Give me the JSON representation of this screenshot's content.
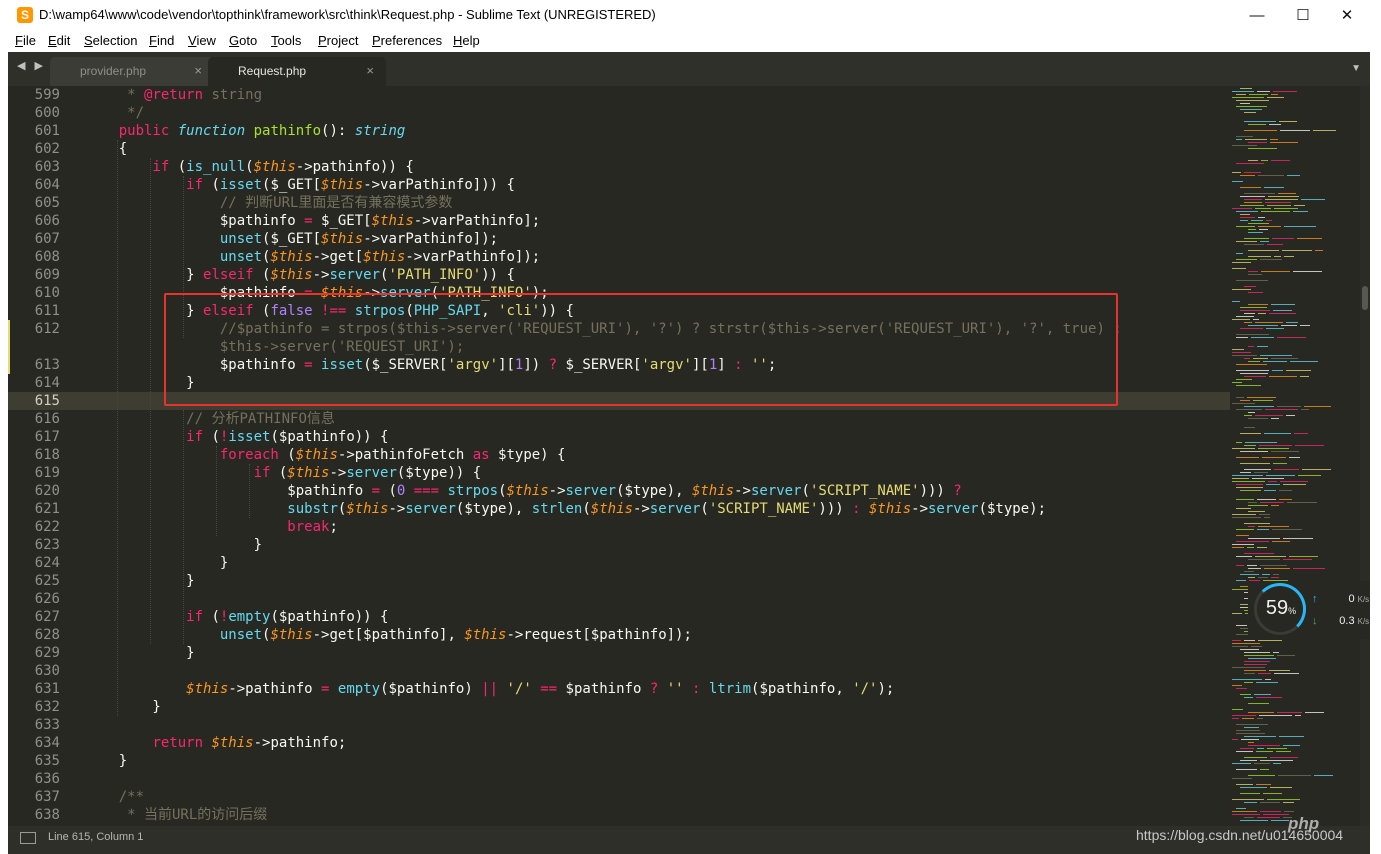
{
  "window": {
    "title": "D:\\wamp64\\www\\code\\vendor\\topthink\\framework\\src\\think\\Request.php - Sublime Text (UNREGISTERED)",
    "app_icon": "sublime-text-icon",
    "controls": {
      "minimize": "—",
      "maximize": "☐",
      "close": "✕"
    }
  },
  "menu": [
    {
      "label": "File",
      "u": "F",
      "rest": "ile"
    },
    {
      "label": "Edit",
      "u": "E",
      "rest": "dit"
    },
    {
      "label": "Selection",
      "u": "S",
      "rest": "election"
    },
    {
      "label": "Find",
      "u": "F",
      "rest": "ind"
    },
    {
      "label": "View",
      "u": "V",
      "rest": "iew"
    },
    {
      "label": "Goto",
      "u": "G",
      "rest": "oto"
    },
    {
      "label": "Tools",
      "u": "T",
      "rest": "ools"
    },
    {
      "label": "Project",
      "u": "P",
      "rest": "roject"
    },
    {
      "label": "Preferences",
      "u": "P",
      "rest": "references"
    },
    {
      "label": "Help",
      "u": "H",
      "rest": "elp"
    }
  ],
  "tabs": [
    {
      "label": "provider.php",
      "active": false
    },
    {
      "label": "Request.php",
      "active": true
    }
  ],
  "tab_close_glyph": "×",
  "nav_arrows": "◀ ▶",
  "tab_menu_glyph": "▼",
  "current_line": 615,
  "code_lines": [
    {
      "n": "599",
      "t": [
        [
          "c",
          "     * "
        ],
        [
          "at",
          "@return"
        ],
        [
          "c",
          " string"
        ]
      ]
    },
    {
      "n": "600",
      "t": [
        [
          "c",
          "     */"
        ]
      ]
    },
    {
      "n": "601",
      "t": [
        [
          "",
          "    "
        ],
        [
          "k",
          "public"
        ],
        [
          "",
          " "
        ],
        [
          "st",
          "function"
        ],
        [
          "",
          " "
        ],
        [
          "f",
          "pathinfo"
        ],
        [
          "",
          "(): "
        ],
        [
          "st",
          "string"
        ]
      ]
    },
    {
      "n": "602",
      "t": [
        [
          "",
          "    {"
        ]
      ]
    },
    {
      "n": "603",
      "t": [
        [
          "",
          "        "
        ],
        [
          "k",
          "if"
        ],
        [
          "",
          " ("
        ],
        [
          "b",
          "is_null"
        ],
        [
          "",
          "("
        ],
        [
          "v",
          "$this"
        ],
        [
          "",
          "->pathinfo)) {"
        ]
      ]
    },
    {
      "n": "604",
      "t": [
        [
          "",
          "            "
        ],
        [
          "k",
          "if"
        ],
        [
          "",
          " ("
        ],
        [
          "b",
          "isset"
        ],
        [
          "",
          "($_GET["
        ],
        [
          "v",
          "$this"
        ],
        [
          "",
          "->varPathinfo])) {"
        ]
      ]
    },
    {
      "n": "605",
      "t": [
        [
          "",
          "                "
        ],
        [
          "c",
          "// 判断URL里面是否有兼容模式参数"
        ]
      ]
    },
    {
      "n": "606",
      "t": [
        [
          "",
          "                $pathinfo "
        ],
        [
          "k",
          "="
        ],
        [
          "",
          " $_GET["
        ],
        [
          "v",
          "$this"
        ],
        [
          "",
          "->varPathinfo];"
        ]
      ]
    },
    {
      "n": "607",
      "t": [
        [
          "",
          "                "
        ],
        [
          "b",
          "unset"
        ],
        [
          "",
          "($_GET["
        ],
        [
          "v",
          "$this"
        ],
        [
          "",
          "->varPathinfo]);"
        ]
      ]
    },
    {
      "n": "608",
      "t": [
        [
          "",
          "                "
        ],
        [
          "b",
          "unset"
        ],
        [
          "",
          "("
        ],
        [
          "v",
          "$this"
        ],
        [
          "",
          "->get["
        ],
        [
          "v",
          "$this"
        ],
        [
          "",
          "->varPathinfo]);"
        ]
      ]
    },
    {
      "n": "609",
      "t": [
        [
          "",
          "            } "
        ],
        [
          "k",
          "elseif"
        ],
        [
          "",
          " ("
        ],
        [
          "v",
          "$this"
        ],
        [
          "",
          "->"
        ],
        [
          "b",
          "server"
        ],
        [
          "",
          "("
        ],
        [
          "s",
          "'PATH_INFO'"
        ],
        [
          "",
          ")) {"
        ]
      ]
    },
    {
      "n": "610",
      "t": [
        [
          "",
          "                $pathinfo "
        ],
        [
          "k",
          "="
        ],
        [
          "",
          " "
        ],
        [
          "v",
          "$this"
        ],
        [
          "",
          "->"
        ],
        [
          "b",
          "server"
        ],
        [
          "",
          "("
        ],
        [
          "s",
          "'PATH_INFO'"
        ],
        [
          "",
          ");"
        ]
      ]
    },
    {
      "n": "611",
      "t": [
        [
          "",
          "            } "
        ],
        [
          "k",
          "elseif"
        ],
        [
          "",
          " ("
        ],
        [
          "n",
          "false"
        ],
        [
          "",
          " "
        ],
        [
          "k",
          "!=="
        ],
        [
          "",
          " "
        ],
        [
          "b",
          "strpos"
        ],
        [
          "",
          "("
        ],
        [
          "b",
          "PHP_SAPI"
        ],
        [
          "",
          ", "
        ],
        [
          "s",
          "'cli'"
        ],
        [
          "",
          ")) {"
        ]
      ]
    },
    {
      "n": "612",
      "t": [
        [
          "",
          "                "
        ],
        [
          "c",
          "//$pathinfo = strpos($this->server('REQUEST_URI'), '?') ? strstr($this->server('REQUEST_URI'), '?', true) :"
        ]
      ]
    },
    {
      "n": "",
      "t": [
        [
          "",
          "                "
        ],
        [
          "c",
          "$this->server('REQUEST_URI');"
        ]
      ]
    },
    {
      "n": "613",
      "t": [
        [
          "",
          "                $pathinfo "
        ],
        [
          "k",
          "="
        ],
        [
          "",
          " "
        ],
        [
          "b",
          "isset"
        ],
        [
          "",
          "($_SERVER["
        ],
        [
          "s",
          "'argv'"
        ],
        [
          "",
          "]["
        ],
        [
          "n",
          "1"
        ],
        [
          "",
          "]) "
        ],
        [
          "k",
          "?"
        ],
        [
          "",
          " $_SERVER["
        ],
        [
          "s",
          "'argv'"
        ],
        [
          "",
          "]["
        ],
        [
          "n",
          "1"
        ],
        [
          "",
          "] "
        ],
        [
          "k",
          ":"
        ],
        [
          "",
          " "
        ],
        [
          "s",
          "''"
        ],
        [
          "",
          ";"
        ]
      ]
    },
    {
      "n": "614",
      "t": [
        [
          "",
          "            }"
        ]
      ]
    },
    {
      "n": "615",
      "t": [
        [
          "",
          ""
        ]
      ]
    },
    {
      "n": "616",
      "t": [
        [
          "",
          "            "
        ],
        [
          "c",
          "// 分析PATHINFO信息"
        ]
      ]
    },
    {
      "n": "617",
      "t": [
        [
          "",
          "            "
        ],
        [
          "k",
          "if"
        ],
        [
          "",
          " ("
        ],
        [
          "k",
          "!"
        ],
        [
          "b",
          "isset"
        ],
        [
          "",
          "($pathinfo)) {"
        ]
      ]
    },
    {
      "n": "618",
      "t": [
        [
          "",
          "                "
        ],
        [
          "k",
          "foreach"
        ],
        [
          "",
          " ("
        ],
        [
          "v",
          "$this"
        ],
        [
          "",
          "->pathinfoFetch "
        ],
        [
          "k",
          "as"
        ],
        [
          "",
          " $type) {"
        ]
      ]
    },
    {
      "n": "619",
      "t": [
        [
          "",
          "                    "
        ],
        [
          "k",
          "if"
        ],
        [
          "",
          " ("
        ],
        [
          "v",
          "$this"
        ],
        [
          "",
          "->"
        ],
        [
          "b",
          "server"
        ],
        [
          "",
          "($type)) {"
        ]
      ]
    },
    {
      "n": "620",
      "t": [
        [
          "",
          "                        $pathinfo "
        ],
        [
          "k",
          "="
        ],
        [
          "",
          " ("
        ],
        [
          "n",
          "0"
        ],
        [
          "",
          " "
        ],
        [
          "k",
          "==="
        ],
        [
          "",
          " "
        ],
        [
          "b",
          "strpos"
        ],
        [
          "",
          "("
        ],
        [
          "v",
          "$this"
        ],
        [
          "",
          "->"
        ],
        [
          "b",
          "server"
        ],
        [
          "",
          "($type), "
        ],
        [
          "v",
          "$this"
        ],
        [
          "",
          "->"
        ],
        [
          "b",
          "server"
        ],
        [
          "",
          "("
        ],
        [
          "s",
          "'SCRIPT_NAME'"
        ],
        [
          "",
          "))) "
        ],
        [
          "k",
          "?"
        ]
      ]
    },
    {
      "n": "621",
      "t": [
        [
          "",
          "                        "
        ],
        [
          "b",
          "substr"
        ],
        [
          "",
          "("
        ],
        [
          "v",
          "$this"
        ],
        [
          "",
          "->"
        ],
        [
          "b",
          "server"
        ],
        [
          "",
          "($type), "
        ],
        [
          "b",
          "strlen"
        ],
        [
          "",
          "("
        ],
        [
          "v",
          "$this"
        ],
        [
          "",
          "->"
        ],
        [
          "b",
          "server"
        ],
        [
          "",
          "("
        ],
        [
          "s",
          "'SCRIPT_NAME'"
        ],
        [
          "",
          "))) "
        ],
        [
          "k",
          ":"
        ],
        [
          "",
          " "
        ],
        [
          "v",
          "$this"
        ],
        [
          "",
          "->"
        ],
        [
          "b",
          "server"
        ],
        [
          "",
          "($type);"
        ]
      ]
    },
    {
      "n": "622",
      "t": [
        [
          "",
          "                        "
        ],
        [
          "k",
          "break"
        ],
        [
          "",
          ";"
        ]
      ]
    },
    {
      "n": "623",
      "t": [
        [
          "",
          "                    }"
        ]
      ]
    },
    {
      "n": "624",
      "t": [
        [
          "",
          "                }"
        ]
      ]
    },
    {
      "n": "625",
      "t": [
        [
          "",
          "            }"
        ]
      ]
    },
    {
      "n": "626",
      "t": [
        [
          "",
          ""
        ]
      ]
    },
    {
      "n": "627",
      "t": [
        [
          "",
          "            "
        ],
        [
          "k",
          "if"
        ],
        [
          "",
          " ("
        ],
        [
          "k",
          "!"
        ],
        [
          "b",
          "empty"
        ],
        [
          "",
          "($pathinfo)) {"
        ]
      ]
    },
    {
      "n": "628",
      "t": [
        [
          "",
          "                "
        ],
        [
          "b",
          "unset"
        ],
        [
          "",
          "("
        ],
        [
          "v",
          "$this"
        ],
        [
          "",
          "->get[$pathinfo], "
        ],
        [
          "v",
          "$this"
        ],
        [
          "",
          "->request[$pathinfo]);"
        ]
      ]
    },
    {
      "n": "629",
      "t": [
        [
          "",
          "            }"
        ]
      ]
    },
    {
      "n": "630",
      "t": [
        [
          "",
          ""
        ]
      ]
    },
    {
      "n": "631",
      "t": [
        [
          "",
          "            "
        ],
        [
          "v",
          "$this"
        ],
        [
          "",
          "->pathinfo "
        ],
        [
          "k",
          "="
        ],
        [
          "",
          " "
        ],
        [
          "b",
          "empty"
        ],
        [
          "",
          "($pathinfo) "
        ],
        [
          "k",
          "||"
        ],
        [
          "",
          " "
        ],
        [
          "s",
          "'/'"
        ],
        [
          "",
          " "
        ],
        [
          "k",
          "=="
        ],
        [
          "",
          " $pathinfo "
        ],
        [
          "k",
          "?"
        ],
        [
          "",
          " "
        ],
        [
          "s",
          "''"
        ],
        [
          "",
          " "
        ],
        [
          "k",
          ":"
        ],
        [
          "",
          " "
        ],
        [
          "b",
          "ltrim"
        ],
        [
          "",
          "($pathinfo, "
        ],
        [
          "s",
          "'/'"
        ],
        [
          "",
          ");"
        ]
      ]
    },
    {
      "n": "632",
      "t": [
        [
          "",
          "        }"
        ]
      ]
    },
    {
      "n": "633",
      "t": [
        [
          "",
          ""
        ]
      ]
    },
    {
      "n": "634",
      "t": [
        [
          "",
          "        "
        ],
        [
          "k",
          "return"
        ],
        [
          "",
          " "
        ],
        [
          "v",
          "$this"
        ],
        [
          "",
          "->pathinfo;"
        ]
      ]
    },
    {
      "n": "635",
      "t": [
        [
          "",
          "    }"
        ]
      ]
    },
    {
      "n": "636",
      "t": [
        [
          "",
          ""
        ]
      ]
    },
    {
      "n": "637",
      "t": [
        [
          "",
          "    "
        ],
        [
          "c",
          "/**"
        ]
      ]
    },
    {
      "n": "638",
      "t": [
        [
          "c",
          "     * 当前URL的访问后缀"
        ]
      ]
    }
  ],
  "status": {
    "position": "Line 615, Column 1",
    "icon": "panel-toggle-icon"
  },
  "network_widget": {
    "percent": "59",
    "percent_sign": "%",
    "upload": "0",
    "download": "0.3",
    "unit": "K/s",
    "up_arrow": "↑",
    "down_arrow": "↓"
  },
  "watermark": "https://blog.csdn.net/u014650004",
  "php_logo": "php",
  "colors": {
    "background": "#272822",
    "keyword": "#f92672",
    "string": "#e6db74",
    "comment": "#75715e",
    "function": "#a6e22e",
    "builtin": "#66d9ef",
    "variable": "#fd971f",
    "number": "#ae81ff",
    "annotation_box": "#e8322b"
  }
}
